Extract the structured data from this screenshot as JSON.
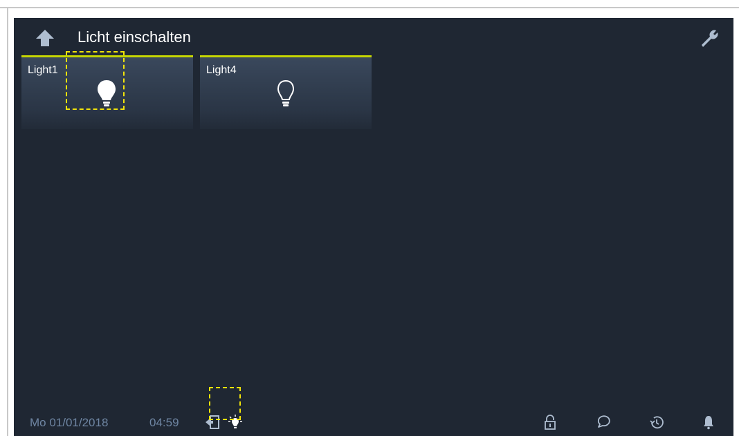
{
  "header": {
    "title": "Licht einschalten",
    "back_icon": "arrow-up-icon",
    "settings_icon": "wrench-icon"
  },
  "tiles": [
    {
      "label": "Light1",
      "icon": "lightbulb-filled-icon",
      "state": "on"
    },
    {
      "label": "Light4",
      "icon": "lightbulb-outline-icon",
      "state": "off"
    }
  ],
  "status_bar": {
    "date": "Mo 01/01/2018",
    "time": "04:59",
    "icons": [
      "door-exit-icon",
      "light-on-icon",
      "lock-icon",
      "message-icon",
      "history-icon",
      "bell-icon"
    ]
  },
  "colors": {
    "background": "#1f2733",
    "accent": "#c6d600",
    "highlight": "#f2e40a",
    "status_text": "#6f86a3"
  }
}
